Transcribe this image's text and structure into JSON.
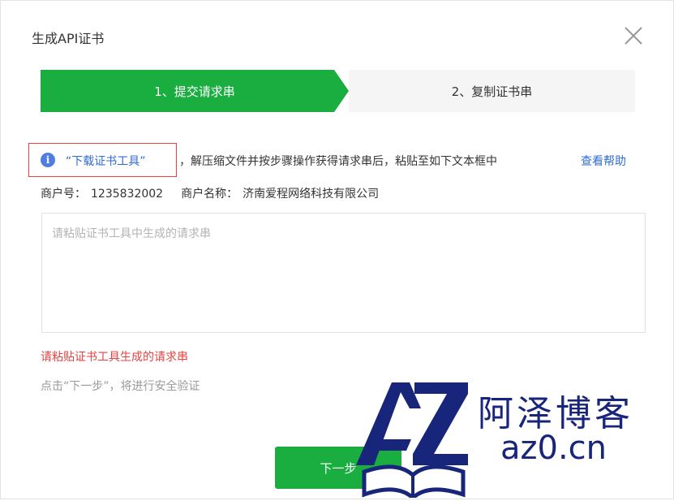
{
  "dialog": {
    "title": "生成API证书"
  },
  "steps": [
    {
      "label": "1、提交请求串",
      "active": true
    },
    {
      "label": "2、复制证书串",
      "active": false
    }
  ],
  "notice": {
    "download_link": "“下载证书工具”",
    "instruction": "，解压缩文件并按步骤操作获得请求串后，粘贴至如下文本框中",
    "help_link": "查看帮助"
  },
  "merchant": {
    "id_label": "商户号：",
    "id_value": "1235832002",
    "name_label": "商户名称：",
    "name_value": "济南爱程网络科技有限公司"
  },
  "request_input": {
    "value": "",
    "placeholder": "请粘贴证书工具中生成的请求串"
  },
  "error_text": "请粘贴证书工具生成的请求串",
  "hint_text": "点击“下一步”，将进行安全验证",
  "next_button": "下一步",
  "watermark": {
    "brand_cn": "阿泽博客",
    "brand_url": "az0.cn"
  },
  "colors": {
    "primary_green": "#1aad3f",
    "link_blue": "#2f6bd8",
    "error_red": "#e64340",
    "watermark_navy": "#17257a"
  }
}
